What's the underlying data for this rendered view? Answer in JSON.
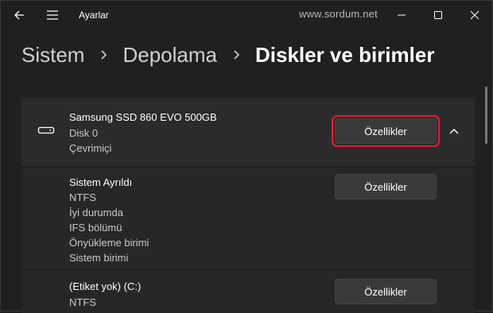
{
  "window": {
    "title": "Ayarlar",
    "watermark": "www.sordum.net"
  },
  "breadcrumb": [
    "Sistem",
    "Depolama",
    "Diskler ve birimler"
  ],
  "disk": {
    "name": "Samsung SSD 860 EVO 500GB",
    "number": "Disk 0",
    "status": "Çevrimiçi",
    "button_label": "Özellikler"
  },
  "volumes": [
    {
      "lines": [
        "Sistem Ayrıldı",
        "NTFS",
        "İyi durumda",
        "IFS bölümü",
        "Önyükleme birimi",
        "Sistem birimi"
      ],
      "button_label": "Özellikler"
    },
    {
      "lines": [
        "(Etiket yok) (C:)",
        "NTFS"
      ],
      "button_label": "Özellikler"
    }
  ],
  "colors": {
    "background": "#202020",
    "card": "#2b2b2b",
    "highlight": "#e0202e"
  },
  "icons": [
    "back-arrow-icon",
    "hamburger-menu-icon",
    "minimize-icon",
    "maximize-icon",
    "close-icon",
    "chevron-right-icon",
    "drive-icon",
    "chevron-up-icon"
  ]
}
